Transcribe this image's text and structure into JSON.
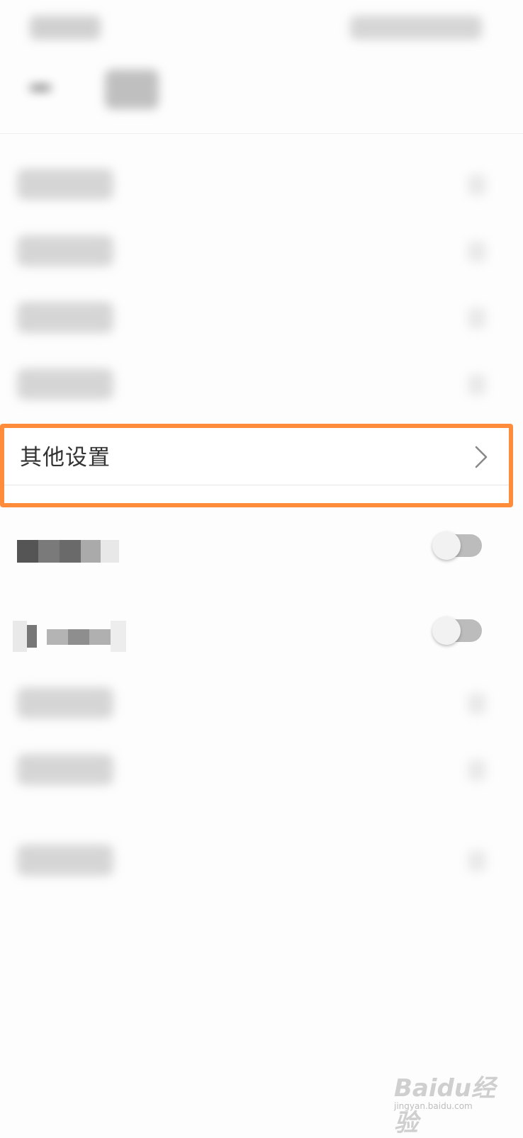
{
  "highlighted_row": {
    "label": "其他设置"
  },
  "icons": {
    "back": "back-arrow-icon",
    "chevron": "chevron-right-icon"
  },
  "colors": {
    "highlight_border": "#ff8c3a",
    "toggle_off_track": "#bcbcbc",
    "toggle_knob": "#f2f2f2"
  },
  "toggles": [
    {
      "state": "off"
    },
    {
      "state": "off"
    }
  ],
  "watermark": {
    "brand": "Baidu经验",
    "url": "jingyan.baidu.com"
  }
}
